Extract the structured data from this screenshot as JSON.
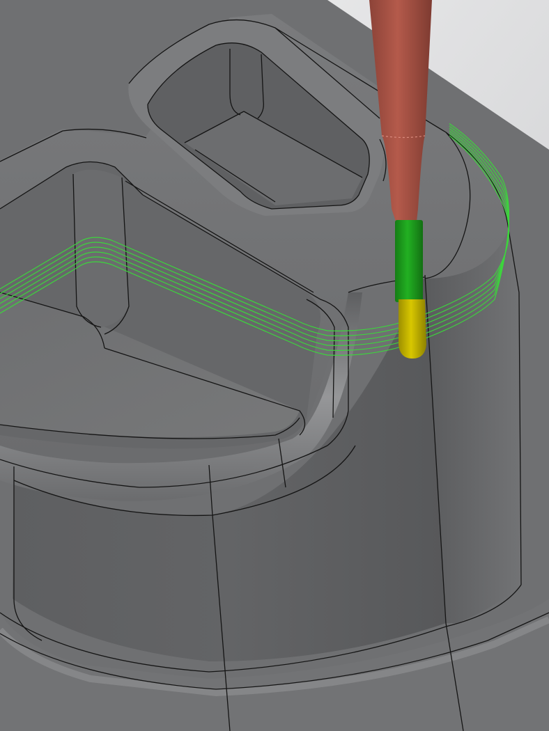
{
  "viewport": {
    "background_top": "#f2f2f3",
    "background_bottom": "#c9cacc"
  },
  "part": {
    "body_color": "#6d6e70",
    "body_light": "#8a8b8d",
    "body_dark": "#505153",
    "edge_color": "#141414"
  },
  "toolpath": {
    "color": "#3cd63c",
    "pass_count": 6
  },
  "tool": {
    "holder_color": "#b45a4b",
    "shank_color": "#1fa01f",
    "ball_tip_color": "#c9b800"
  }
}
